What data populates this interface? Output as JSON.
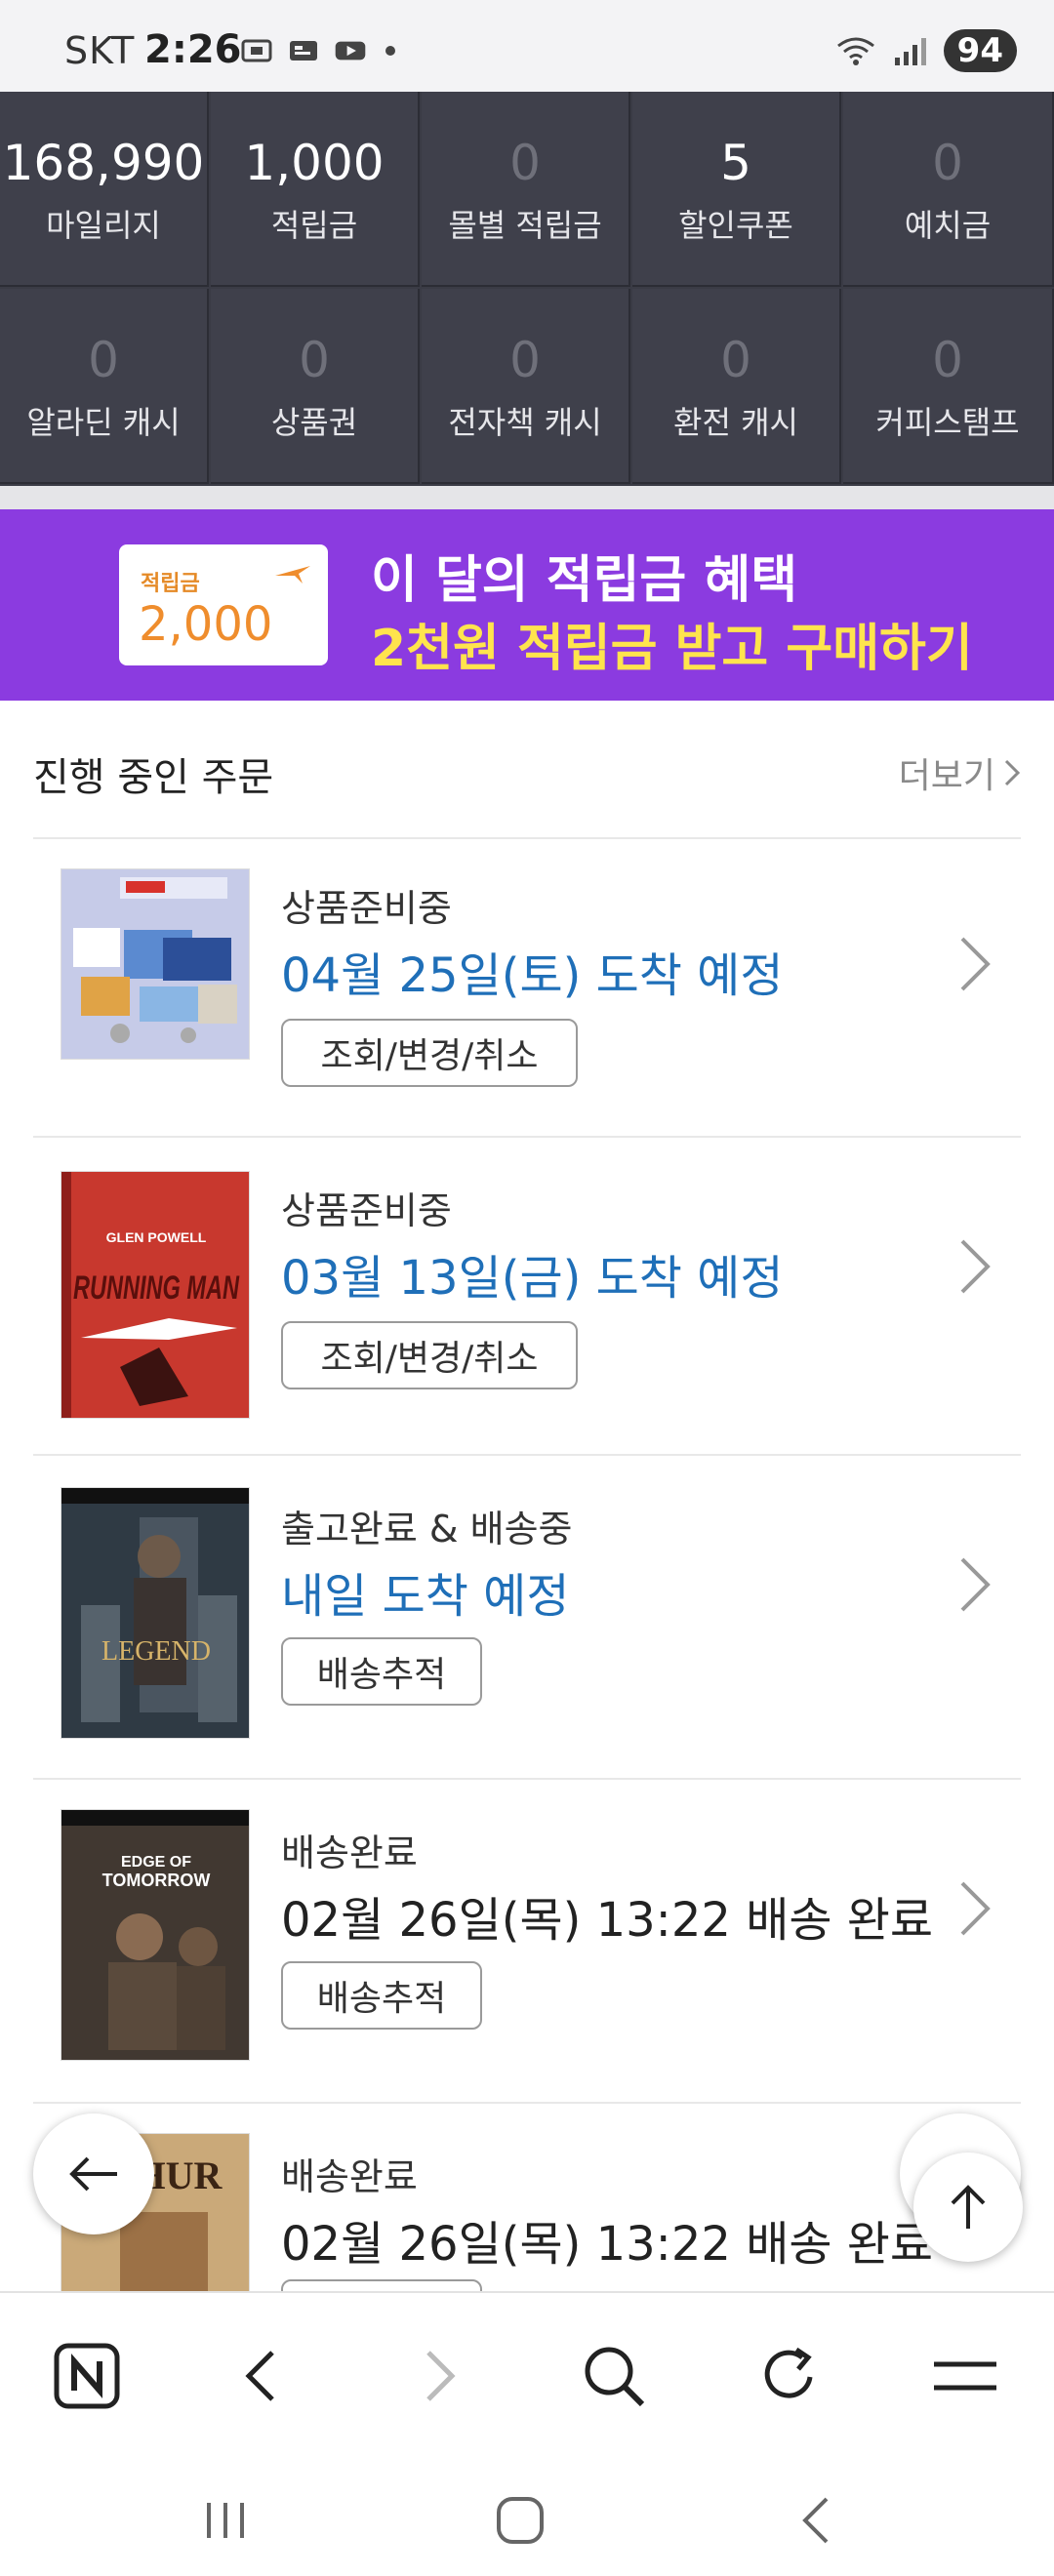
{
  "status_bar": {
    "carrier": "SKT",
    "time": "2:26",
    "battery": "94"
  },
  "points": {
    "row1": [
      {
        "value": "168,990",
        "label": "마일리지"
      },
      {
        "value": "1,000",
        "label": "적립금"
      },
      {
        "value": "0",
        "label": "몰별 적립금"
      },
      {
        "value": "5",
        "label": "할인쿠폰"
      },
      {
        "value": "0",
        "label": "예치금"
      }
    ],
    "row2": [
      {
        "value": "0",
        "label": "알라딘 캐시"
      },
      {
        "value": "0",
        "label": "상품권"
      },
      {
        "value": "0",
        "label": "전자책 캐시"
      },
      {
        "value": "0",
        "label": "환전 캐시"
      },
      {
        "value": "0",
        "label": "커피스탬프"
      }
    ]
  },
  "banner": {
    "coupon_label": "적립금",
    "coupon_amount": "2,000",
    "line1": "이 달의 적립금 혜택",
    "line2": "2천원 적립금 받고 구매하기",
    "colors": {
      "background": "#8b3be0",
      "line2": "#ffe44d",
      "coupon_text": "#ef8d2d"
    }
  },
  "section": {
    "title": "진행 중인 주문",
    "more": "더보기"
  },
  "orders": [
    {
      "status": "상품준비중",
      "eta": "04월 25일(토) 도착 예정",
      "button": "조회/변경/취소",
      "eta_color": "blue"
    },
    {
      "status": "상품준비중",
      "eta": "03월 13일(금) 도착 예정",
      "button": "조회/변경/취소",
      "eta_color": "blue"
    },
    {
      "status": "출고완료 & 배송중",
      "eta": "내일 도착 예정",
      "button": "배송추적",
      "eta_color": "blue"
    },
    {
      "status": "배송완료",
      "eta": "02월 26일(목) 13:22 배송 완료",
      "button": "배송추적",
      "eta_color": "dark"
    },
    {
      "status": "배송완료",
      "eta": "02월 26일(목) 13:22 배송 완료",
      "button": "",
      "eta_color": "dark"
    }
  ],
  "thumbnails": {
    "order2_text1": "GLEN POWELL",
    "order2_text2": "RUNNING MAN",
    "order3_text": "LEGEND",
    "order4_text1": "EDGE OF",
    "order4_text2": "TOMORROW",
    "order5_text": "HUR"
  },
  "browser_bar": {
    "icons": [
      "naver-n-icon",
      "back-icon",
      "forward-icon",
      "search-icon",
      "refresh-icon",
      "menu-icon"
    ]
  },
  "floating": {
    "left": "back-arrow-icon",
    "right": "scroll-top-icon"
  },
  "nav_bar": {
    "icons": [
      "recent-apps-icon",
      "home-icon",
      "back-icon"
    ]
  }
}
